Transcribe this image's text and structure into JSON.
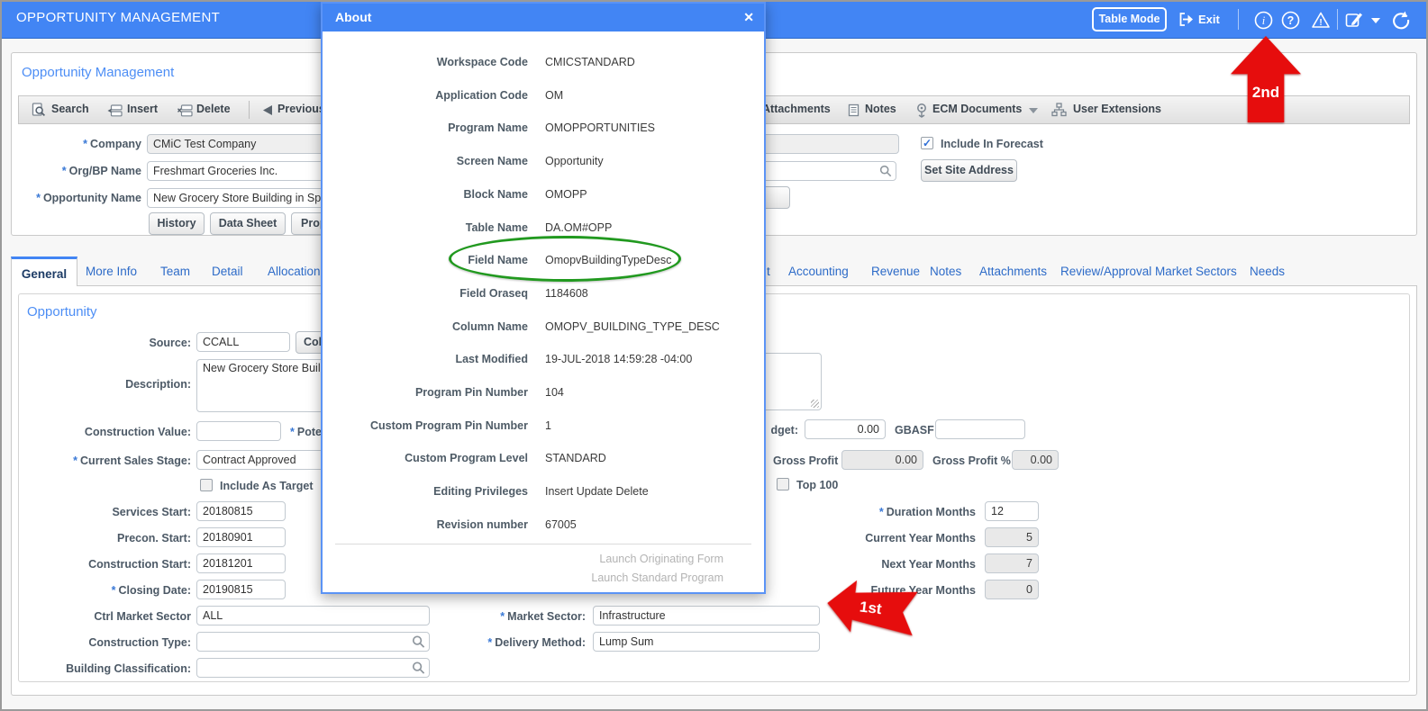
{
  "ui": {
    "required_marker": "*"
  },
  "icons": {
    "check": "✓",
    "close": "✕",
    "info": "i",
    "help": "?",
    "warn": "!"
  },
  "header": {
    "title": "OPPORTUNITY MANAGEMENT",
    "table_mode": "Table Mode",
    "exit": "Exit"
  },
  "annotations": {
    "first": "1st",
    "second": "2nd"
  },
  "top_panel": {
    "heading": "Opportunity Management",
    "toolbar": {
      "search": "Search",
      "insert": "Insert",
      "delete": "Delete",
      "previous": "Previous",
      "attachments": "Attachments",
      "notes": "Notes",
      "ecm": "ECM Documents",
      "user_ext": "User Extensions"
    },
    "company_label": "Company",
    "company_value": "CMiC Test Company",
    "orgbp_label": "Org/BP Name",
    "orgbp_value": "Freshmart Groceries Inc.",
    "oppname_label": "Opportunity Name",
    "oppname_value": "New Grocery Store Building in Spri",
    "include_forecast": "Include In Forecast",
    "set_site_address": "Set Site Address",
    "history": "History",
    "data_sheet": "Data Sheet",
    "proposal": "Proposa"
  },
  "tabs": {
    "left": [
      "General",
      "More Info",
      "Team",
      "Detail",
      "Allocation"
    ],
    "right": [
      "t",
      "Accounting",
      "Revenue",
      "Notes",
      "Attachments",
      "Review/Approval",
      "Market Sectors",
      "Needs"
    ]
  },
  "dialog": {
    "title": "About",
    "rows": [
      {
        "label": "Workspace Code",
        "value": "CMICSTANDARD"
      },
      {
        "label": "Application Code",
        "value": "OM"
      },
      {
        "label": "Program Name",
        "value": "OMOPPORTUNITIES"
      },
      {
        "label": "Screen Name",
        "value": "Opportunity"
      },
      {
        "label": "Block Name",
        "value": "OMOPP"
      },
      {
        "label": "Table Name",
        "value": "DA.OM#OPP"
      },
      {
        "label": "Field Name",
        "value": "OmopvBuildingTypeDesc"
      },
      {
        "label": "Field Oraseq",
        "value": "1184608"
      },
      {
        "label": "Column Name",
        "value": "OMOPV_BUILDING_TYPE_DESC"
      },
      {
        "label": "Last Modified",
        "value": "19-JUL-2018 14:59:28 -04:00"
      },
      {
        "label": "Program Pin Number",
        "value": "104"
      },
      {
        "label": "Custom Program Pin Number",
        "value": "1"
      },
      {
        "label": "Custom Program Level",
        "value": "STANDARD"
      },
      {
        "label": "Editing Privileges",
        "value": "Insert Update Delete"
      },
      {
        "label": "Revision number",
        "value": "67005"
      }
    ],
    "links": [
      "Launch Originating Form",
      "Launch Standard Program"
    ]
  },
  "main": {
    "heading": "Opportunity",
    "source_label": "Source:",
    "source_value": "CCALL",
    "source_button": "Colo",
    "description_label": "Description:",
    "description_value": "New Grocery Store Build",
    "construction_value_label": "Construction Value:",
    "potential_fragment": "Poten",
    "sales_stage_label": "Current Sales Stage:",
    "sales_stage_value": "Contract Approved",
    "include_as_target": "Include As Target",
    "services_start_label": "Services Start:",
    "services_start_value": "20180815",
    "precon_start_label": "Precon. Start:",
    "precon_start_value": "20180901",
    "construction_start_label": "Construction Start:",
    "construction_start_value": "20181201",
    "closing_date_label": "Closing Date:",
    "closing_date_value": "20190815",
    "ctrl_market_sector_label": "Ctrl Market Sector",
    "ctrl_market_sector_value": "ALL",
    "construction_type_label": "Construction Type:",
    "building_class_label": "Building Classification:",
    "market_sector_label": "Market Sector:",
    "market_sector_value": "Infrastructure",
    "delivery_method_label": "Delivery Method:",
    "delivery_method_value": "Lump Sum",
    "budget_fragment": "dget:",
    "budget_value": "0.00",
    "gbasf_label": "GBASF",
    "gross_profit_label": "Gross Profit",
    "gross_profit_value": "0.00",
    "gross_profit_pct_label": "Gross Profit %:",
    "gross_profit_pct_value": "0.00",
    "top100_label": "Top 100",
    "duration_label": "Duration Months",
    "duration_value": "12",
    "cur_year_label": "Current Year Months",
    "cur_year_value": "5",
    "next_year_label": "Next Year Months",
    "next_year_value": "7",
    "future_year_label": "Future Year Months",
    "future_year_value": "0"
  }
}
